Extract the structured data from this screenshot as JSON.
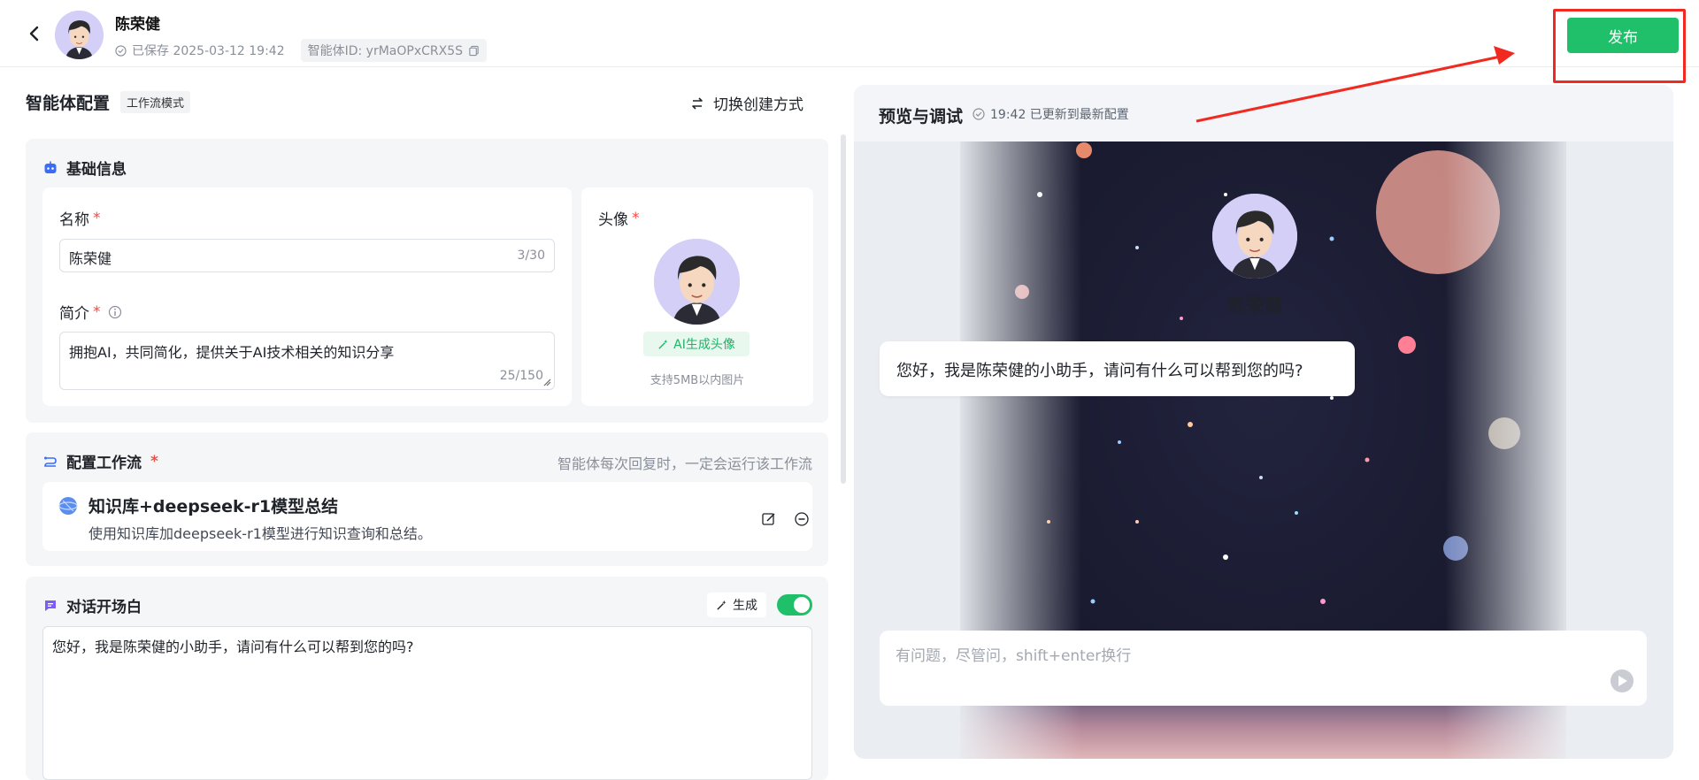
{
  "header": {
    "agent_name": "陈荣健",
    "saved_status": "已保存 2025-03-12 19:42",
    "agent_id": "智能体ID: yrMaOPxCRX5S",
    "publish_label": "发布"
  },
  "config": {
    "title": "智能体配置",
    "mode_tag": "工作流模式",
    "switch_label": "切换创建方式",
    "basic": {
      "section_title": "基础信息",
      "name_label": "名称",
      "name_value": "陈荣健",
      "name_counter": "3/30",
      "desc_label": "简介",
      "desc_value": "拥抱AI，共同简化，提供关于AI技术相关的知识分享",
      "desc_counter": "25/150",
      "avatar_label": "头像",
      "ai_avatar_label": "AI生成头像",
      "avatar_hint": "支持5MB以内图片"
    },
    "workflow": {
      "section_title": "配置工作流",
      "hint": "智能体每次回复时，一定会运行该工作流",
      "item_name": "知识库+deepseek-r1模型总结",
      "item_desc": "使用知识库加deepseek-r1模型进行知识查询和总结。"
    },
    "opening": {
      "section_title": "对话开场白",
      "generate_label": "生成",
      "toggle_on": true,
      "text": "您好，我是陈荣健的小助手，请问有什么可以帮到您的吗?"
    }
  },
  "preview": {
    "title": "预览与调试",
    "status": "19:42 已更新到最新配置",
    "agent_name": "陈荣健",
    "greeting": "您好，我是陈荣健的小助手，请问有什么可以帮到您的吗?",
    "input_placeholder": "有问题，尽管问，shift+enter换行"
  },
  "colors": {
    "accent_green": "#20c06b",
    "highlight_red": "#f02a20",
    "avatar_bg": "#d4cff7"
  }
}
